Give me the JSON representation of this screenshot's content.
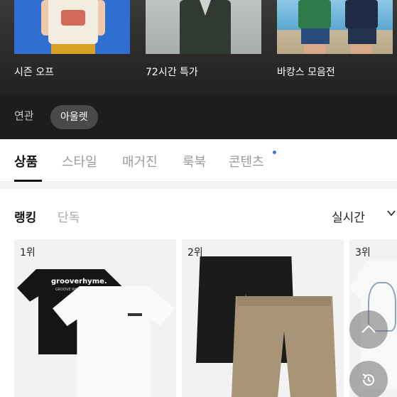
{
  "banner": {
    "promos": [
      {
        "label": "시즌 오프"
      },
      {
        "label": "72시간 특가"
      },
      {
        "label": "바캉스 모음전"
      }
    ],
    "related_label": "연관",
    "related_chip": "아울렛"
  },
  "tabs": [
    {
      "label": "상품",
      "active": true
    },
    {
      "label": "스타일",
      "active": false
    },
    {
      "label": "매거진",
      "active": false
    },
    {
      "label": "룩북",
      "active": false
    },
    {
      "label": "콘텐츠",
      "active": false,
      "has_new_dot": true
    }
  ],
  "ranking": {
    "sub_tabs": [
      {
        "label": "랭킹",
        "active": true
      },
      {
        "label": "단독",
        "active": false
      }
    ],
    "period": "실시간",
    "products": [
      {
        "rank": "1위",
        "image_text": "grooverhyme.",
        "image_subtext": "GROOVE RHYME"
      },
      {
        "rank": "2위"
      },
      {
        "rank": "3위"
      }
    ]
  },
  "floating_buttons": [
    "scroll-top-icon",
    "history-icon"
  ],
  "colors": {
    "banner_bg": "#1d1d1d",
    "chip_bg": "#4a4a4a",
    "dot": "#3a7bd5",
    "active_text": "#111111",
    "inactive_text": "#9a9a9a"
  }
}
